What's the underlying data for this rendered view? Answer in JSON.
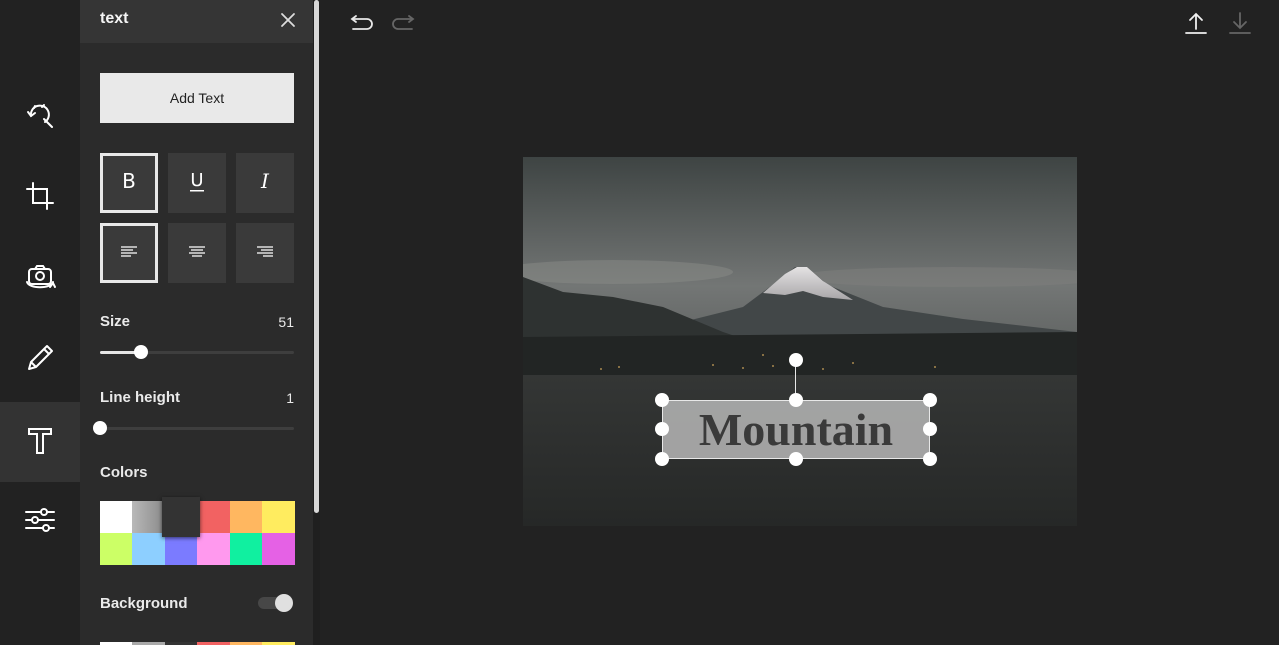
{
  "panel": {
    "title": "text",
    "add_text_label": "Add Text",
    "size_label": "Size",
    "size_value": "51",
    "size_fraction": 0.21,
    "line_height_label": "Line height",
    "line_height_value": "1",
    "line_height_fraction": 0.0,
    "colors_label": "Colors",
    "background_label": "Background",
    "background_enabled": false,
    "format_buttons": [
      {
        "name": "bold",
        "glyph": "B",
        "selected": true
      },
      {
        "name": "underline",
        "glyph": "U",
        "selected": false
      },
      {
        "name": "italic",
        "glyph": "I",
        "selected": false
      }
    ],
    "align_buttons": [
      {
        "name": "align-left",
        "selected": true
      },
      {
        "name": "align-center",
        "selected": false
      },
      {
        "name": "align-right",
        "selected": false
      }
    ],
    "colors": [
      "#ffffff",
      "#a9a9a9",
      "#333333",
      "#f26262",
      "#ffb760",
      "#ffec5f",
      "#ccff66",
      "#8dcfff",
      "#7b7bff",
      "#ff99ee",
      "#10f0a0",
      "#e561e5"
    ],
    "selected_color_index": 2
  },
  "rail": {
    "tools": [
      "magic-wand-icon",
      "crop-icon",
      "rotate-camera-icon",
      "pencil-icon",
      "text-tool-icon",
      "adjust-sliders-icon"
    ],
    "active_index": 4
  },
  "canvas": {
    "text": "Mountain"
  },
  "colors": {
    "accent": "#e8e8e8",
    "background": "#222222",
    "panel": "#2b2b2b"
  }
}
